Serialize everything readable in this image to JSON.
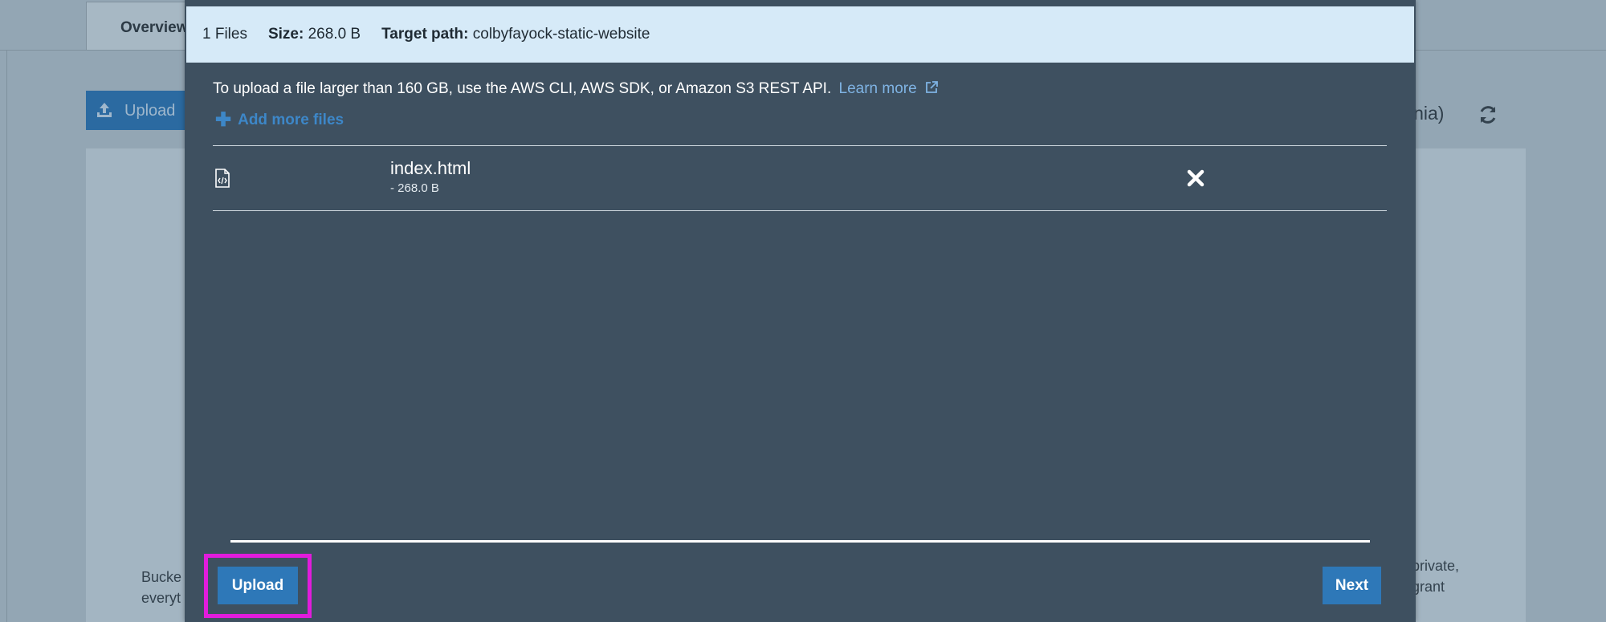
{
  "background": {
    "tab_label": "Overview",
    "upload_button_label": "Upload",
    "region_fragment": "inia)",
    "left_text_lines": [
      "Bucke",
      "everyt"
    ],
    "right_text_lines": [
      "private,",
      "grant"
    ],
    "icons": {
      "upload": "upload-icon",
      "refresh": "refresh-icon"
    }
  },
  "modal": {
    "summary": {
      "files_count": "1 Files",
      "size_label": "Size:",
      "size_value": "268.0 B",
      "target_label": "Target path:",
      "target_value": "colbyfayock-static-website"
    },
    "info_text": "To upload a file larger than 160 GB, use the AWS CLI, AWS SDK, or Amazon S3 REST API.",
    "learn_more_label": "Learn more",
    "add_more_label": "Add more files",
    "files": [
      {
        "name": "index.html",
        "size": "- 268.0 B",
        "icon": "code-file-icon"
      }
    ],
    "upload_button_label": "Upload",
    "next_button_label": "Next"
  },
  "colors": {
    "modal_bg": "#3e5060",
    "summary_bg": "#d6eaf8",
    "primary_button": "#2e78b8",
    "link": "#7fb3e3",
    "highlight": "#e11cdc"
  }
}
